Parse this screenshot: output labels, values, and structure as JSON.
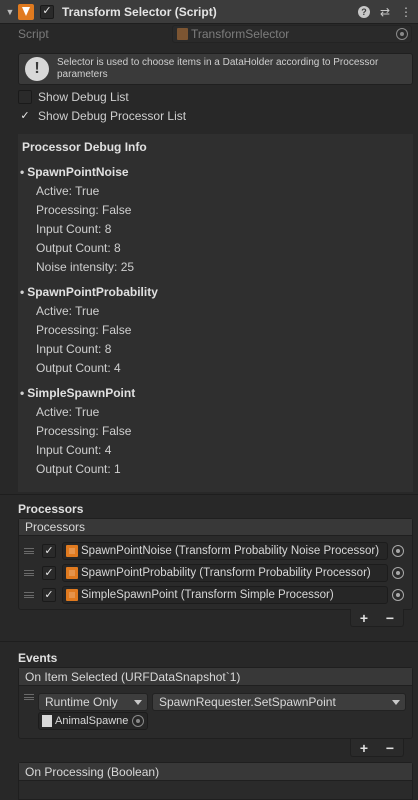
{
  "header": {
    "title": "Transform Selector (Script)",
    "enabled_check": "✓",
    "fold_glyph": "▼",
    "help_glyph": "?",
    "preset_glyph": "⇄",
    "menu_glyph": "⋮",
    "icon": "transform-selector-script-icon"
  },
  "script": {
    "label": "Script",
    "value": "TransformSelector"
  },
  "help": {
    "icon_glyph": "!",
    "text": "Selector is used to choose items in a DataHolder according to Processor parameters"
  },
  "toggles": [
    {
      "label": "Show Debug List",
      "checked": false,
      "glyph": ""
    },
    {
      "label": "Show Debug Processor List",
      "checked": true,
      "glyph": "✓"
    }
  ],
  "debug": {
    "title": "Processor Debug Info",
    "bullet": "•",
    "processors": [
      {
        "name": "SpawnPointNoise",
        "lines": [
          "Active: True",
          "Processing: False",
          "Input Count: 8",
          "Output Count: 8",
          "Noise intensity: 25"
        ]
      },
      {
        "name": "SpawnPointProbability",
        "lines": [
          "Active: True",
          "Processing: False",
          "Input Count: 8",
          "Output Count: 4"
        ]
      },
      {
        "name": "SimpleSpawnPoint",
        "lines": [
          "Active: True",
          "Processing: False",
          "Input Count: 4",
          "Output Count: 1"
        ]
      }
    ]
  },
  "processors_section": {
    "title": "Processors",
    "list_header": "Processors",
    "items": [
      {
        "label": "SpawnPointNoise (Transform Probability Noise Processor)",
        "check": "✓"
      },
      {
        "label": "SpawnPointProbability (Transform Probability Processor)",
        "check": "✓"
      },
      {
        "label": "SimpleSpawnPoint (Transform Simple Processor)",
        "check": "✓"
      }
    ],
    "add_glyph": "+",
    "remove_glyph": "−"
  },
  "events": {
    "title": "Events",
    "on_item_selected": {
      "header": "On Item Selected (URFDataSnapshot`1)",
      "runtime": "Runtime Only",
      "function": "SpawnRequester.SetSpawnPoint",
      "target_object": "AnimalSpawne",
      "check": "",
      "add_glyph": "+",
      "remove_glyph": "−"
    },
    "on_processing": {
      "header": "On Processing (Boolean)"
    }
  },
  "colors": {
    "background": "#282828",
    "header": "#3c3c3c",
    "accent_orange": "#e07a1f"
  }
}
